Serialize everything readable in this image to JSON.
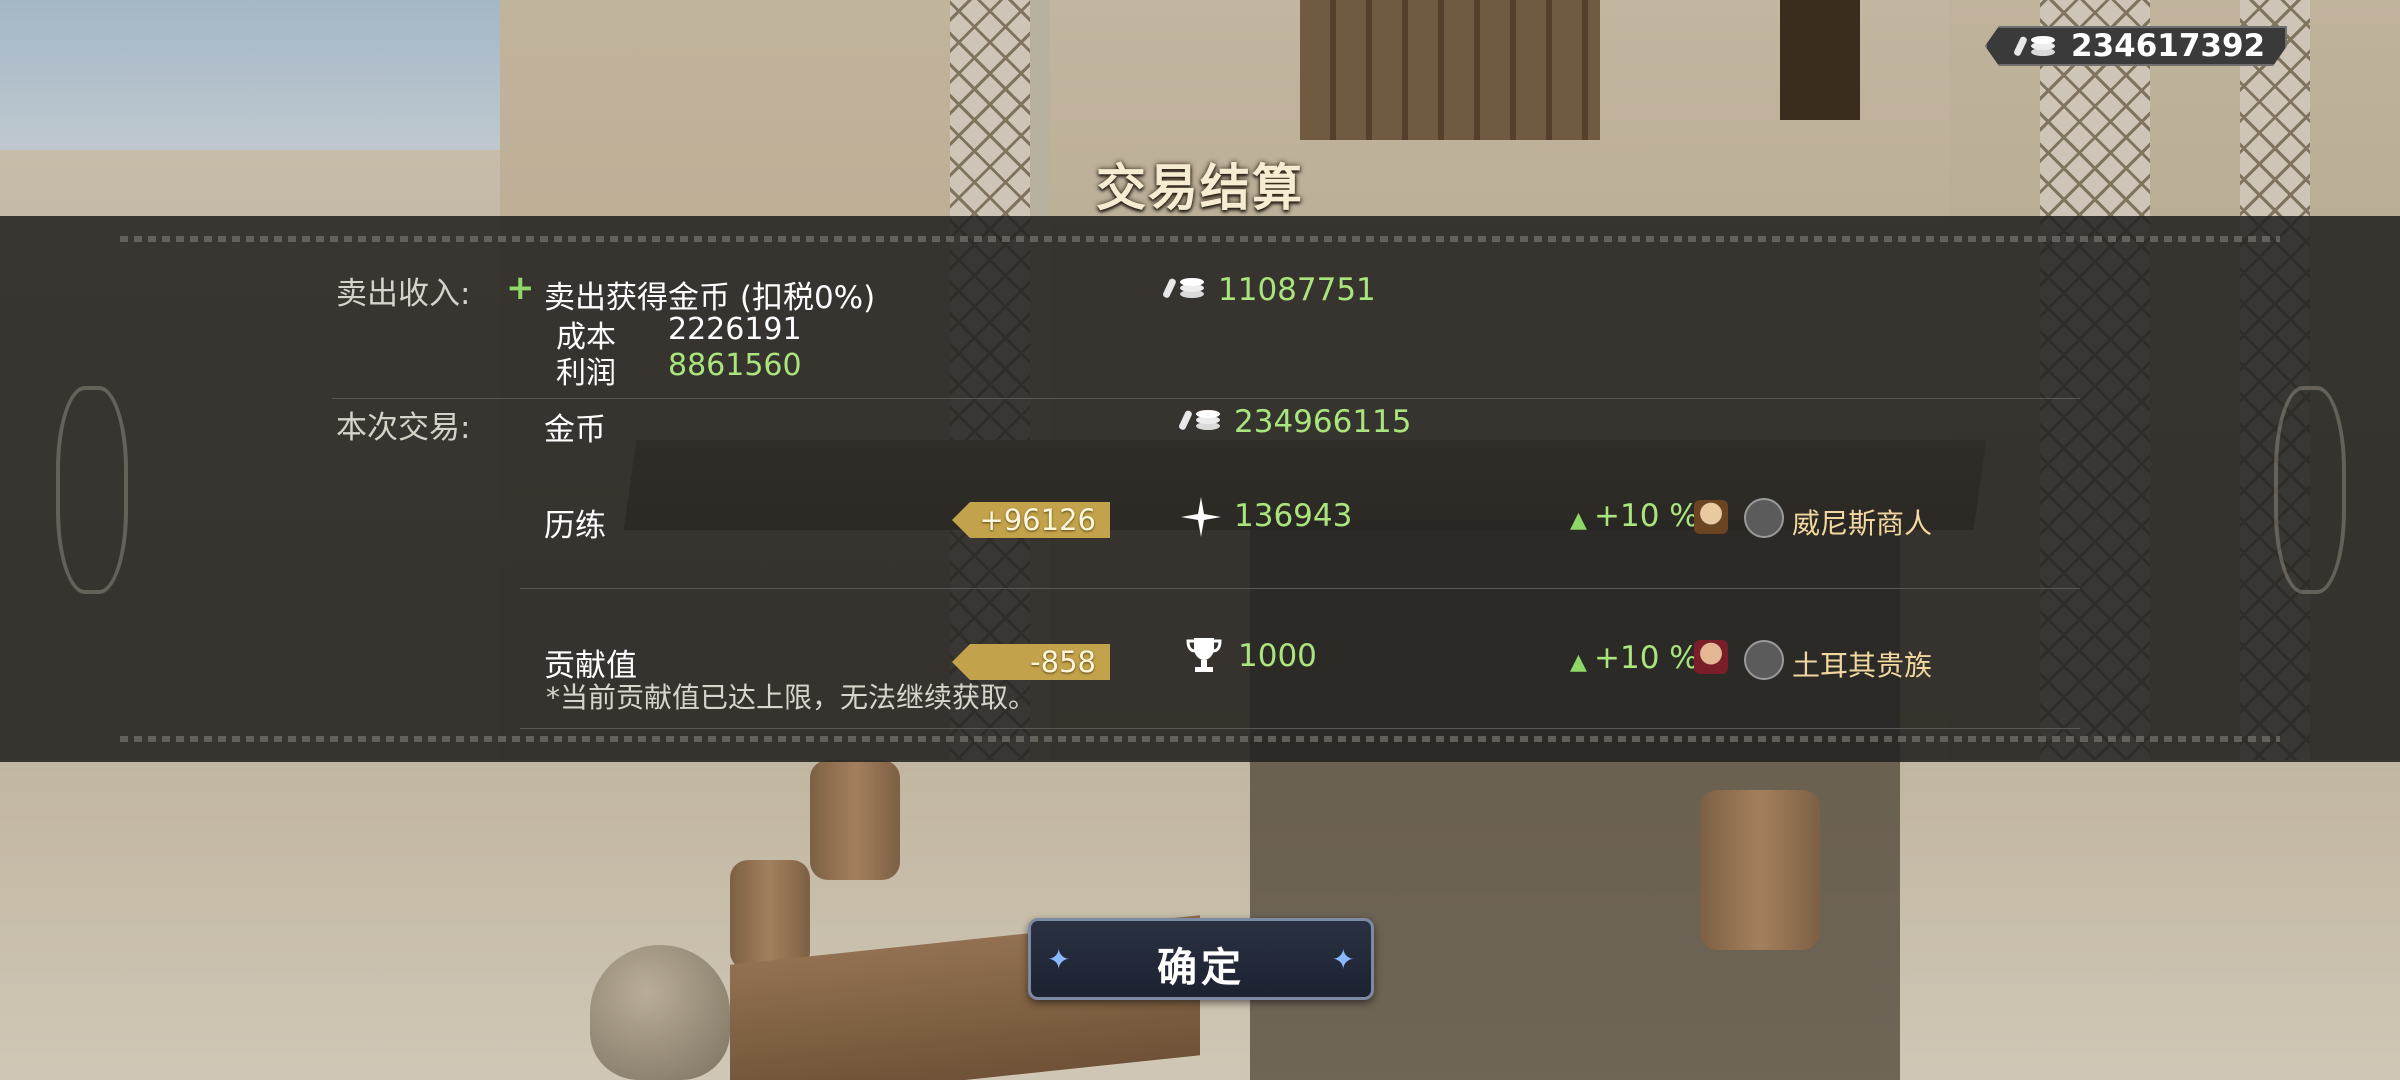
{
  "wallet": {
    "coins": "234617392",
    "icon": "coin-stack-icon"
  },
  "title": "交易结算",
  "sale_income": {
    "label": "卖出收入:",
    "item_label": "卖出获得金币 (扣税0%)",
    "amount": "11087751",
    "cost_label": "成本",
    "cost_value": "2226191",
    "profit_label": "利润",
    "profit_value": "8861560"
  },
  "this_trade": {
    "label": "本次交易:",
    "coins_label": "金币",
    "coins_value": "234966115"
  },
  "experience": {
    "label": "历练",
    "gain": "+96126",
    "total": "136943",
    "bonus": "+10 %",
    "merchant": "威尼斯商人"
  },
  "contribution": {
    "label": "贡献值",
    "gain": "-858",
    "total": "1000",
    "bonus": "+10 %",
    "merchant": "土耳其贵族",
    "note": "*当前贡献值已达上限，无法继续获取。"
  },
  "confirm_label": "确定",
  "colors": {
    "positive": "#a9e47d",
    "tag": "#c2a24a",
    "panel": "#242321"
  }
}
